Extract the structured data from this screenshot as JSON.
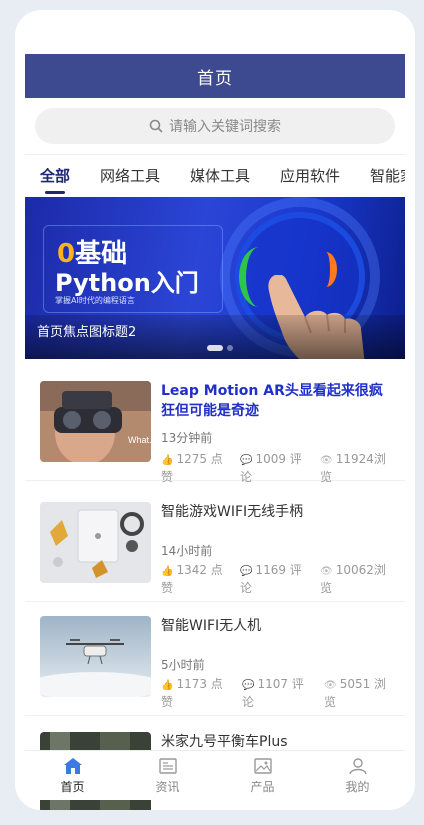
{
  "header": {
    "title": "首页"
  },
  "search": {
    "placeholder": "请输入关键词搜索"
  },
  "tabs": [
    "全部",
    "网络工具",
    "媒体工具",
    "应用软件",
    "智能家"
  ],
  "banner": {
    "line1_prefix": "0",
    "line1_rest": "基础",
    "line2": "Python入门",
    "line3": "掌握AI时代的编程语言",
    "caption": "首页焦点图标题2"
  },
  "articles": [
    {
      "title_line1": "Leap Motion AR头显看起来很疯",
      "title_line2": "狂但可能是奇迹",
      "time": "13分钟前",
      "likes": "1275 点",
      "likes_cont": "赞",
      "comments": "1009 评",
      "comments_cont": "论",
      "views": "11924浏",
      "views_cont": "览",
      "highlight": true
    },
    {
      "title_line1": "智能游戏WIFI无线手柄",
      "title_line2": "",
      "time": "14小时前",
      "likes": "1342 点",
      "likes_cont": "赞",
      "comments": "1169 评",
      "comments_cont": "论",
      "views": "10062浏",
      "views_cont": "览",
      "highlight": false
    },
    {
      "title_line1": "智能WIFI无人机",
      "title_line2": "",
      "time": "5小时前",
      "likes": "1173 点",
      "likes_cont": "赞",
      "comments": "1107 评",
      "comments_cont": "论",
      "views": "5051 浏",
      "views_cont": "览",
      "highlight": false
    },
    {
      "title_line1": "米家九号平衡车Plus",
      "title_line2": "",
      "time": "",
      "highlight": false
    }
  ],
  "tabbar": [
    {
      "label": "首页",
      "icon": "home-icon"
    },
    {
      "label": "资讯",
      "icon": "news-icon"
    },
    {
      "label": "产品",
      "icon": "image-icon"
    },
    {
      "label": "我的",
      "icon": "user-icon"
    }
  ],
  "colors": {
    "header": "#3d4a8f",
    "accent": "#1f2fc8",
    "tab_active": "#1f2a6e"
  }
}
